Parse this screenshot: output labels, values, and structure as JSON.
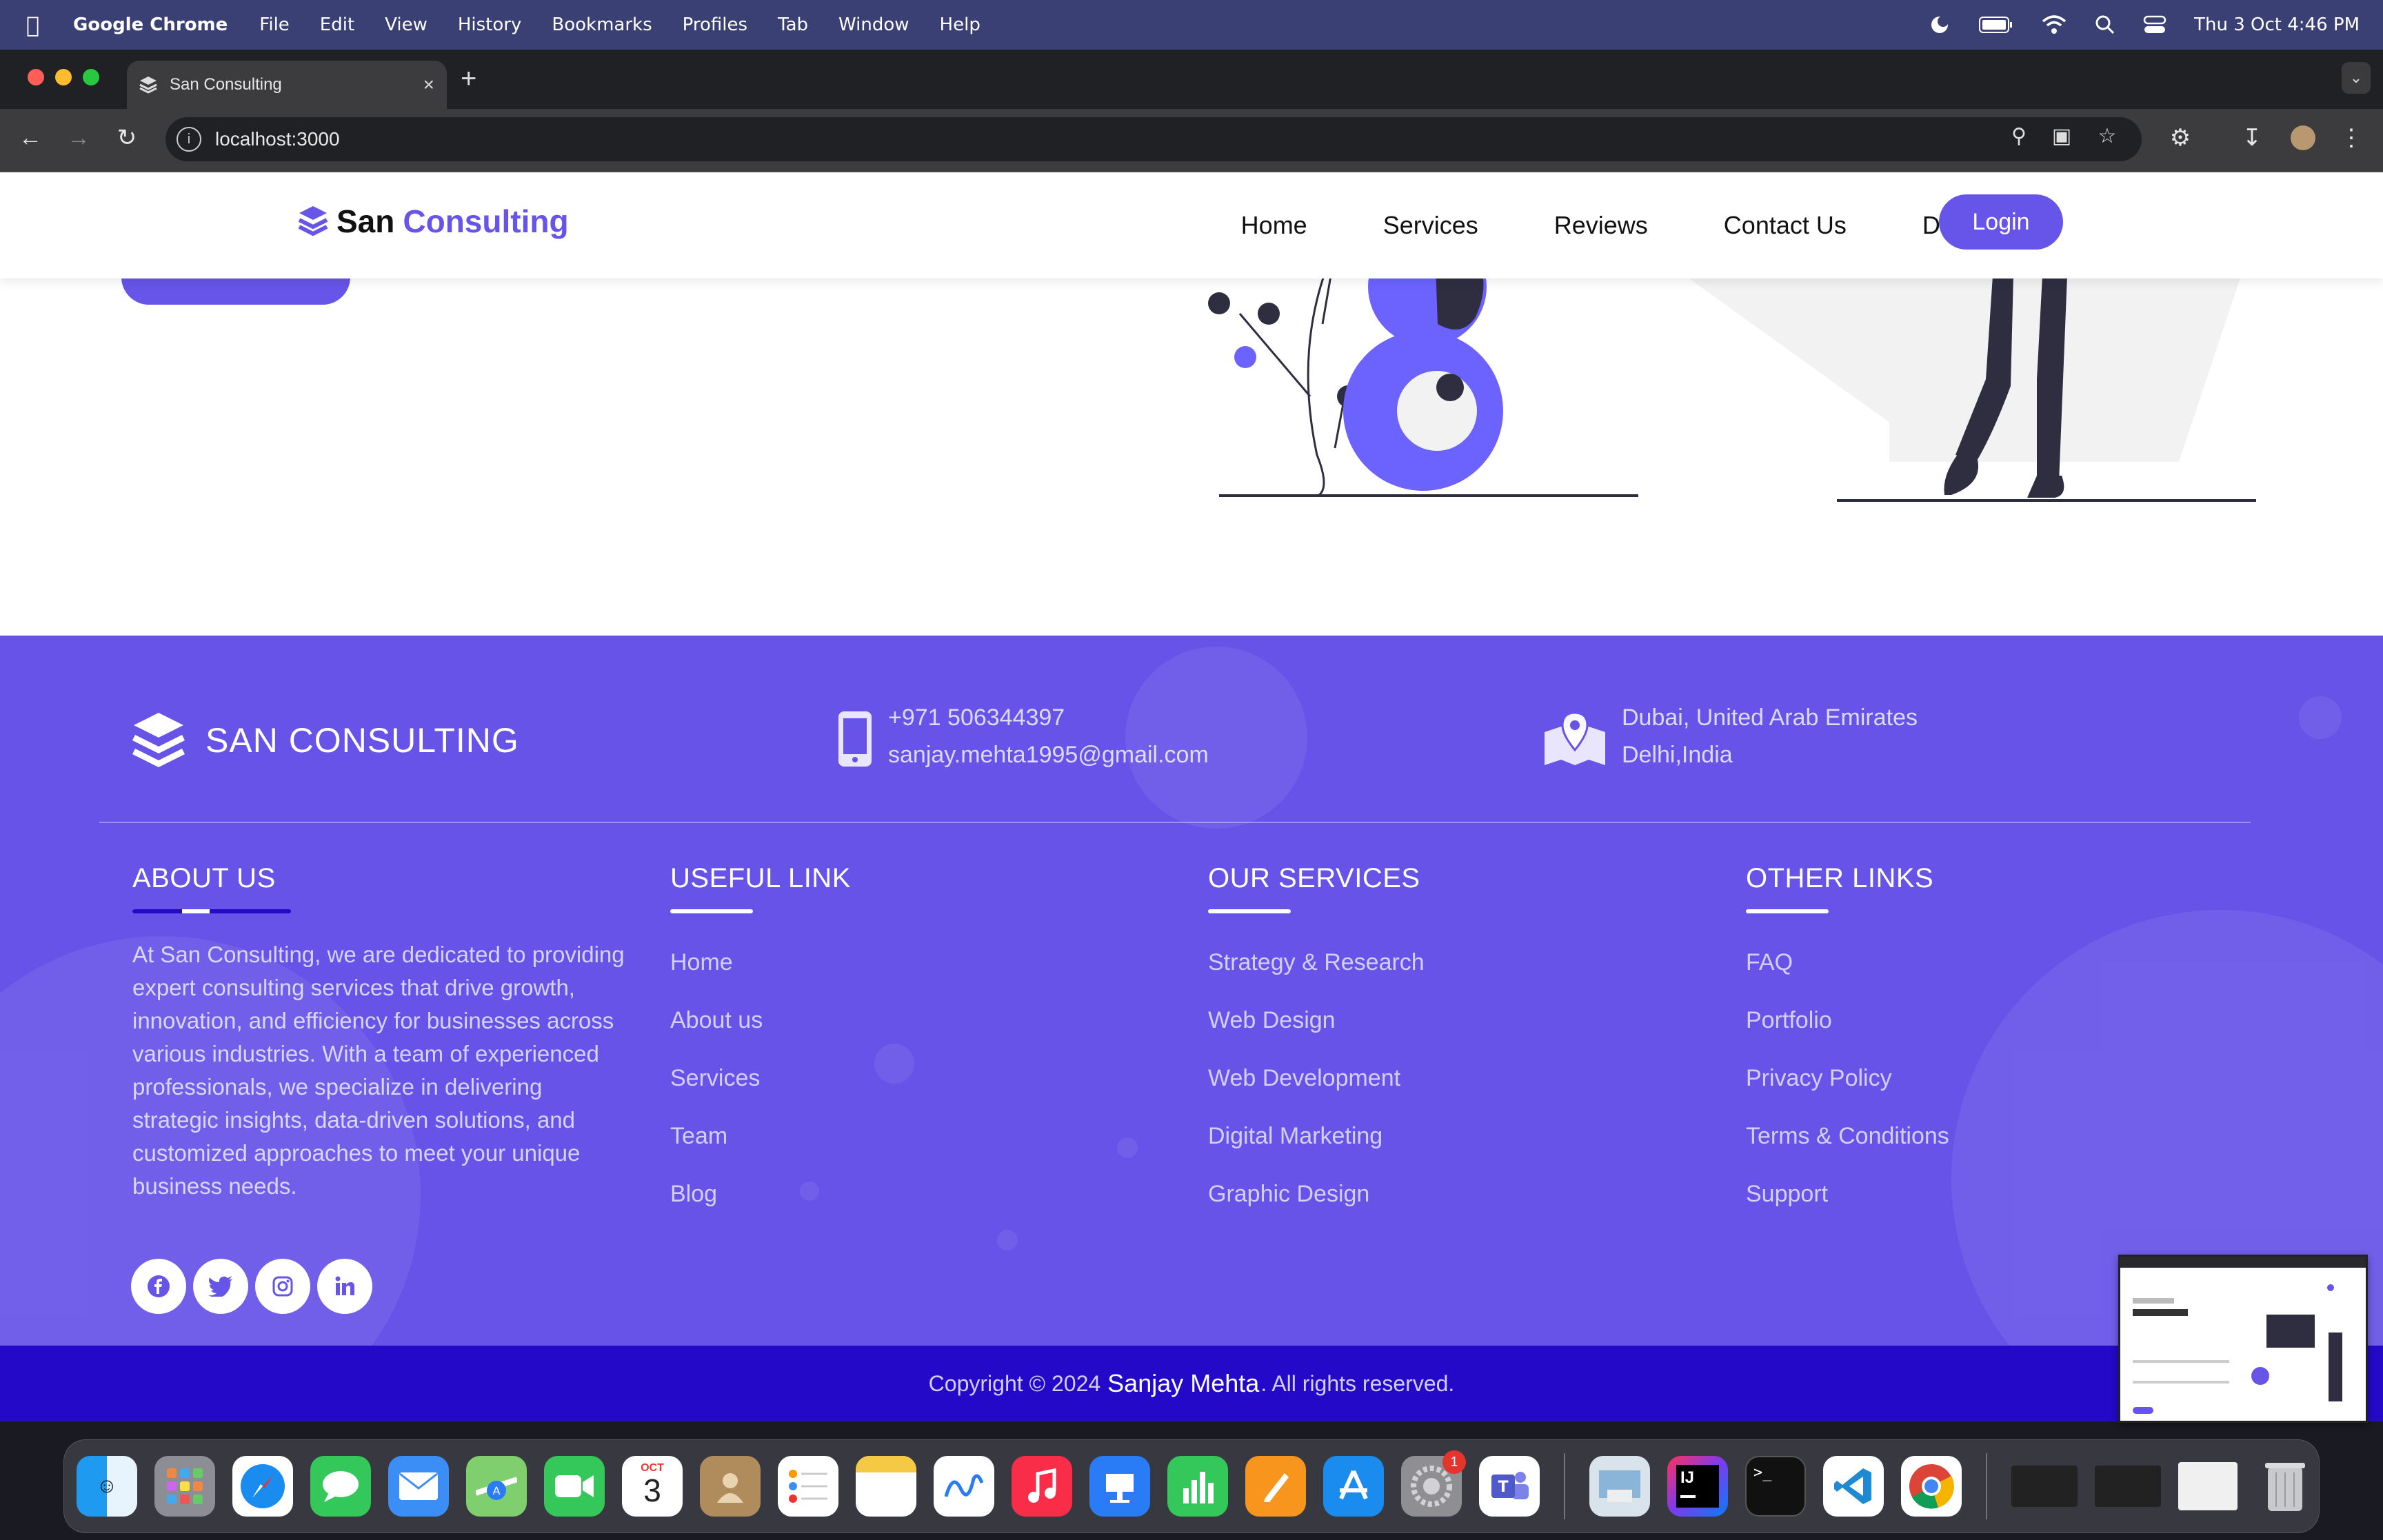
{
  "menubar": {
    "app": "Google Chrome",
    "items": [
      "File",
      "Edit",
      "View",
      "History",
      "Bookmarks",
      "Profiles",
      "Tab",
      "Window",
      "Help"
    ],
    "datetime": "Thu 3 Oct  4:46 PM"
  },
  "browser": {
    "tab_title": "San Consulting",
    "tab_close": "×",
    "new_tab": "+",
    "url": "localhost:3000"
  },
  "nav": {
    "brand_first": "San",
    "brand_second": "Consulting",
    "links": [
      "Home",
      "Services",
      "Reviews",
      "Contact Us",
      "Dashboard"
    ],
    "login": "Login"
  },
  "footer": {
    "brand": "SAN CONSULTING",
    "phone": "+971 506344397",
    "email": "sanjay.mehta1995@gmail.com",
    "address_line1": "Dubai, United Arab Emirates",
    "address_line2": "Delhi,India",
    "about": {
      "heading": "ABOUT US",
      "text": "At San Consulting, we are dedicated to providing expert consulting services that drive growth, innovation, and efficiency for businesses across various industries. With a team of experienced professionals, we specialize in delivering strategic insights, data-driven solutions, and customized approaches to meet your unique business needs."
    },
    "useful": {
      "heading": "USEFUL LINK",
      "items": [
        "Home",
        "About us",
        "Services",
        "Team",
        "Blog"
      ]
    },
    "services": {
      "heading": "OUR SERVICES",
      "items": [
        "Strategy & Research",
        "Web Design",
        "Web Development",
        "Digital Marketing",
        "Graphic Design"
      ]
    },
    "other": {
      "heading": "OTHER LINKS",
      "items": [
        "FAQ",
        "Portfolio",
        "Privacy Policy",
        "Terms & Conditions",
        "Support"
      ]
    },
    "socials": [
      "f",
      "t",
      "ig",
      "in"
    ],
    "copyright_pre": "Copyright © 2024",
    "copyright_name": "Sanjay Mehta",
    "copyright_post": ". All rights reserved."
  },
  "dock": {
    "calendar_month": "OCT",
    "calendar_day": "3",
    "settings_badge": "1",
    "intellij_label": "IJ",
    "terminal_label": ">_"
  },
  "colors": {
    "accent": "#6754e8",
    "footer_bg": "#6753e8",
    "copyright_bg": "#2409c9"
  }
}
